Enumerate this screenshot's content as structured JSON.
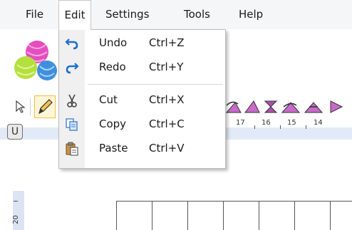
{
  "menubar": {
    "items": [
      "File",
      "Edit",
      "Settings",
      "Tools",
      "Help"
    ],
    "active_index": 1
  },
  "edit_menu": {
    "items": [
      {
        "label": "Undo",
        "shortcut": "Ctrl+Z",
        "icon": "undo-icon"
      },
      {
        "label": "Redo",
        "shortcut": "Ctrl+Y",
        "icon": "redo-icon"
      },
      {
        "label": "Cut",
        "shortcut": "Ctrl+X",
        "icon": "cut-icon"
      },
      {
        "label": "Copy",
        "shortcut": "Ctrl+C",
        "icon": "copy-icon"
      },
      {
        "label": "Paste",
        "shortcut": "Ctrl+V",
        "icon": "paste-icon"
      }
    ]
  },
  "toolbar": {
    "u_button": "U",
    "pointer_icon": "pointer-icon",
    "pencil_icon": "pencil-icon"
  },
  "ruler": {
    "numbers": [
      "17",
      "16",
      "15",
      "14"
    ]
  },
  "side_ruler": {
    "number": "20"
  },
  "colors": {
    "menubar_bg": "#f5f6f7",
    "ruler_band": "#e3eaf7",
    "purple_accent": "#b04fb0"
  }
}
